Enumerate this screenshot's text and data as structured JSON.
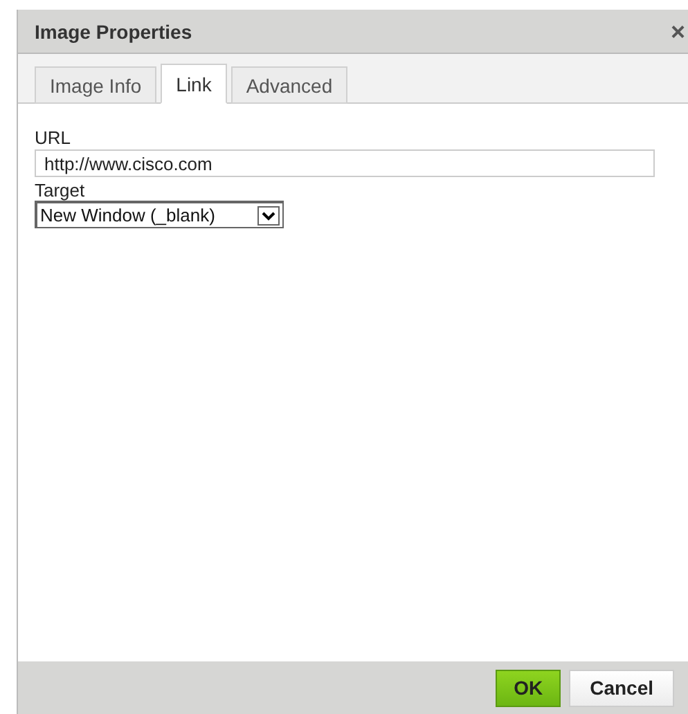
{
  "window": {
    "title": "Image Properties",
    "close": "×"
  },
  "tabs": [
    {
      "label": "Image Info",
      "selected": false
    },
    {
      "label": "Link",
      "selected": true
    },
    {
      "label": "Advanced",
      "selected": false
    }
  ],
  "fields": [
    {
      "kind": "text",
      "label": "URL",
      "value": "http://www.cisco.com"
    },
    {
      "kind": "select",
      "label": "Target",
      "value": "New Window (_blank)"
    }
  ],
  "buttons": [
    {
      "label": "OK",
      "kind": "primary"
    },
    {
      "label": "Cancel",
      "kind": "secondary"
    }
  ]
}
